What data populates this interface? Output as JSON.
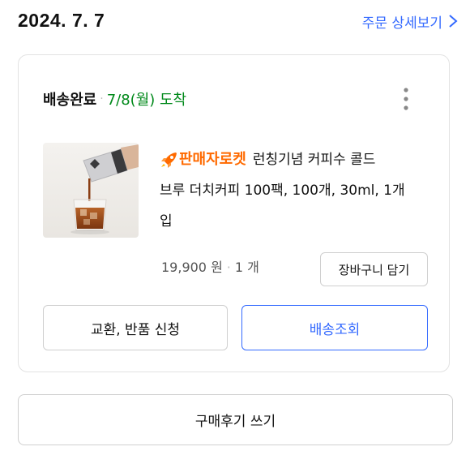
{
  "order": {
    "date": "2024. 7. 7",
    "detail_link": "주문 상세보기"
  },
  "shipment": {
    "status": "배송완료",
    "arrival": "7/8(월) 도착",
    "status_color": "#00891a"
  },
  "product": {
    "badge_text": "판매자로켓",
    "badge_icon": "rocket-icon",
    "name_line1": "런칭기념 커피수 콜드",
    "name_line2": "브루 더치커피 100팩, 100개, 30ml, 1개",
    "name_line3": "입",
    "price": "19,900 원",
    "quantity": "1 개",
    "image_icon": "product-image"
  },
  "buttons": {
    "add_to_cart": "장바구니 담기",
    "exchange_return": "교환, 반품 신청",
    "track_delivery": "배송조회",
    "write_review": "구매후기 쓰기"
  },
  "colors": {
    "accent": "#346aff",
    "rocket": "#ff6a00",
    "delivered": "#00891a"
  }
}
